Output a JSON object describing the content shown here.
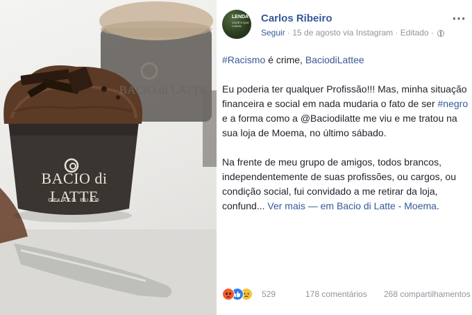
{
  "post": {
    "author": "Carlos Ribeiro",
    "avatar_text": "LENDA",
    "avatar_subtext": "VOCÊ E QUE CONTA",
    "meta": {
      "follow": "Seguir",
      "sep1": " · ",
      "date_source": "15 de agosto via Instagram",
      "sep2": " · ",
      "edited": "Editado",
      "sep3": " · "
    },
    "more_icon": "⋯",
    "paragraph1": {
      "hashtag": "#Racismo",
      "middle": " é crime, ",
      "mention": "BaciodiLattee"
    },
    "paragraph2": {
      "part1": "Eu poderia ter qualquer Profissão!!! Mas, minha situação financeira e social em nada mudaria o fato de ser ",
      "hashtag": "#negro",
      "part2": " e a forma como a @Baciodilatte me viu e me tratou na sua loja de Moema, no último sábado."
    },
    "paragraph3": {
      "part1": "Na frente de meu grupo de amigos, todos brancos, independentemente de suas profissões, ou cargos, ou condição social, fui convidado a me retirar da loja, confund... ",
      "see_more": "Ver mais",
      "dash_em": " — em ",
      "place": "Bacio di Latte - Moema",
      "end": "."
    },
    "footer": {
      "reaction_icons": [
        "angry-icon",
        "like-icon",
        "sad-icon"
      ],
      "reactions_count": "529",
      "comments": "178 comentários",
      "shares": "268 compartilhamentos"
    },
    "photo": {
      "cup_brand": "BACIO di LATTE",
      "cup_sub": "GELATO PURO",
      "back_brand": "BACIO di LATTE"
    }
  },
  "colors": {
    "link": "#365899",
    "meta": "#90949c",
    "text": "#1d2129",
    "cup": "#3a3531",
    "gelato": "#5b3a26"
  }
}
